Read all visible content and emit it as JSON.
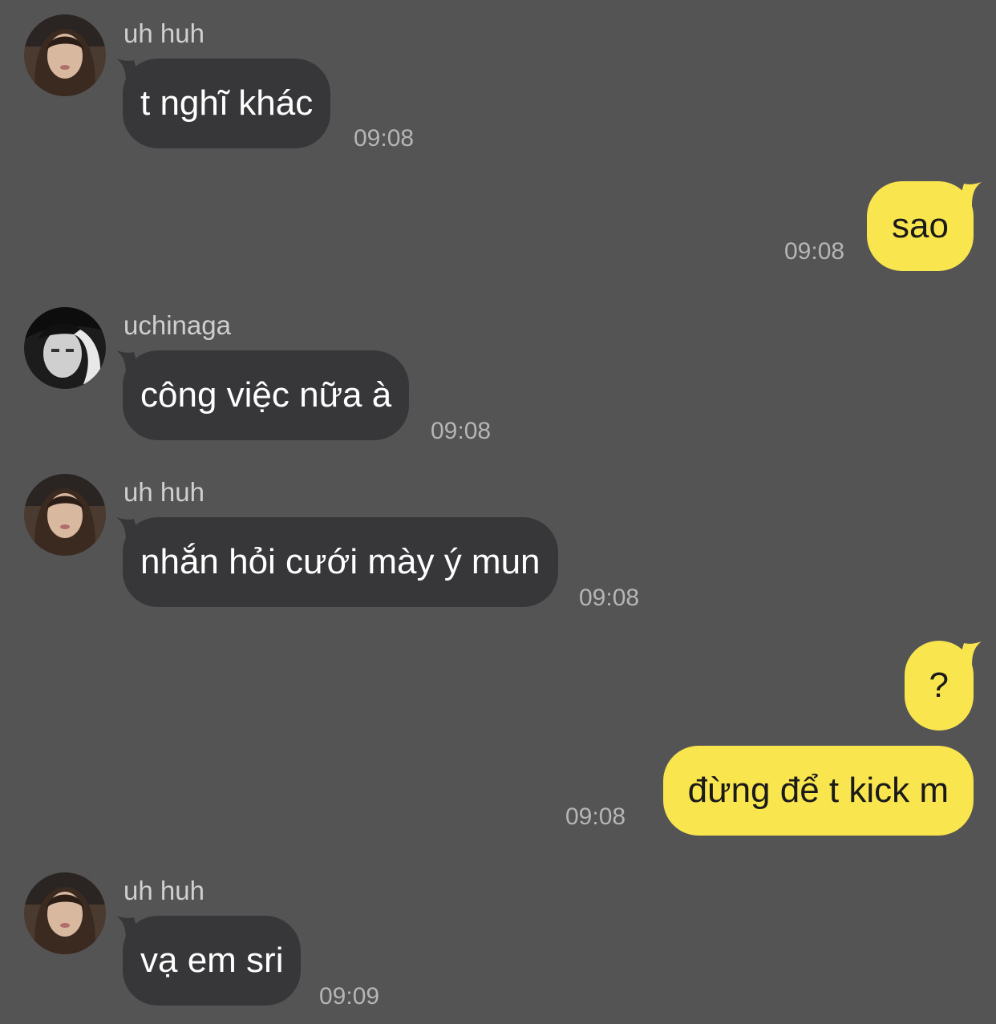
{
  "messages": [
    {
      "sender": "uh huh",
      "text": "t nghĩ khác",
      "time": "09:08",
      "direction": "incoming"
    },
    {
      "text": "sao",
      "time": "09:08",
      "direction": "outgoing"
    },
    {
      "sender": "uchinaga",
      "text": "công việc nữa à",
      "time": "09:08",
      "direction": "incoming"
    },
    {
      "sender": "uh huh",
      "text": "nhắn hỏi cưới mày ý mun",
      "time": "09:08",
      "direction": "incoming"
    },
    {
      "text": "?",
      "direction": "outgoing"
    },
    {
      "text": "đừng để t kick m",
      "time": "09:08",
      "direction": "outgoing"
    },
    {
      "sender": "uh huh",
      "text": "vạ em sri",
      "time": "09:09",
      "direction": "incoming"
    }
  ],
  "colors": {
    "background": "#555455",
    "incoming_bubble": "#373639",
    "outgoing_bubble": "#f9e54e",
    "timestamp": "#b5b5b5",
    "sender_name": "#cfcfcf"
  }
}
